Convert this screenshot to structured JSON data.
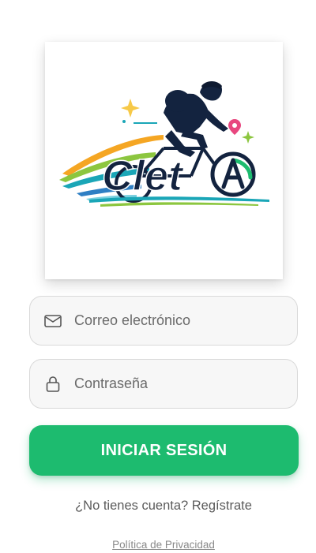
{
  "logo": {
    "text": "Cleta",
    "icon": "cyclist-logo"
  },
  "form": {
    "email": {
      "placeholder": "Correo electrónico",
      "value": "",
      "icon": "mail-icon"
    },
    "password": {
      "placeholder": "Contraseña",
      "value": "",
      "icon": "lock-icon"
    }
  },
  "actions": {
    "login_label": "INICIAR SESIÓN",
    "register_label": "¿No tienes cuenta? Regístrate",
    "privacy_label": "Política de Privacidad"
  },
  "colors": {
    "primary": "#1dbb6f",
    "navy": "#13233f",
    "text_muted": "#6a6a6a"
  }
}
